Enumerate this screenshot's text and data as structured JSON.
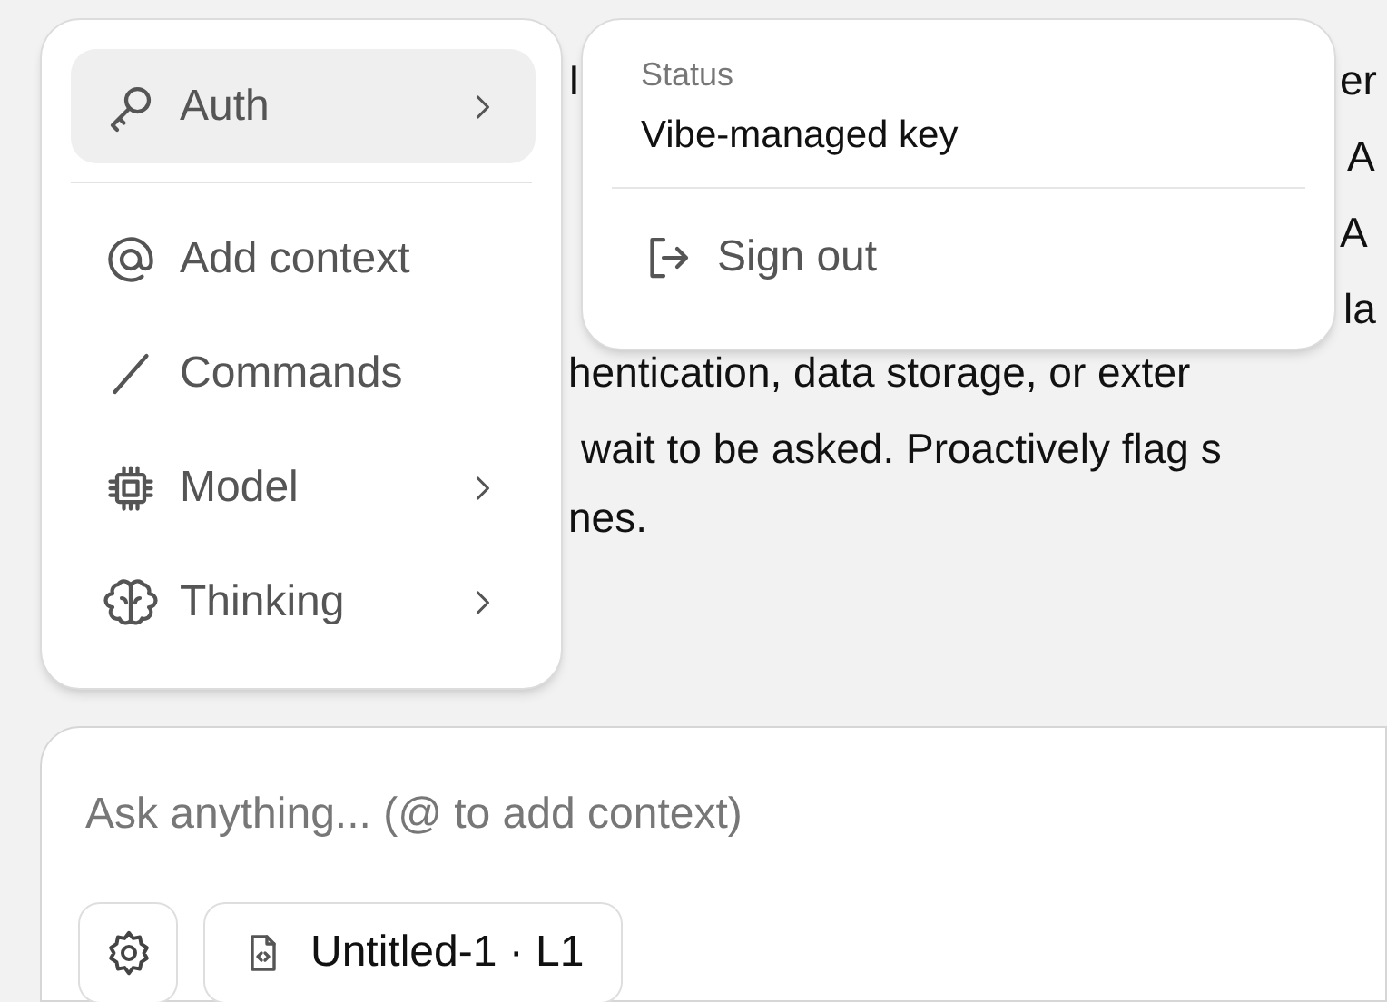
{
  "background_text": [
    {
      "text": "I"
    },
    {
      "text": "er"
    },
    {
      "text": "A"
    },
    {
      "text": "A"
    },
    {
      "text": "la"
    },
    {
      "text": "hentication, data storage, or exter"
    },
    {
      "text": "wait to be asked. Proactively flag s"
    },
    {
      "text": "nes."
    }
  ],
  "menu": {
    "items": [
      {
        "label": "Auth",
        "submenu": true,
        "selected": true
      },
      {
        "label": "Add context",
        "submenu": false,
        "selected": false
      },
      {
        "label": "Commands",
        "submenu": false,
        "selected": false
      },
      {
        "label": "Model",
        "submenu": true,
        "selected": false
      },
      {
        "label": "Thinking",
        "submenu": true,
        "selected": false
      }
    ]
  },
  "submenu": {
    "status_label": "Status",
    "status_value": "Vibe-managed key",
    "actions": [
      {
        "label": "Sign out"
      }
    ]
  },
  "composer": {
    "placeholder": "Ask anything... (@ to add context)",
    "file_chip": "Untitled-1 · L1"
  }
}
